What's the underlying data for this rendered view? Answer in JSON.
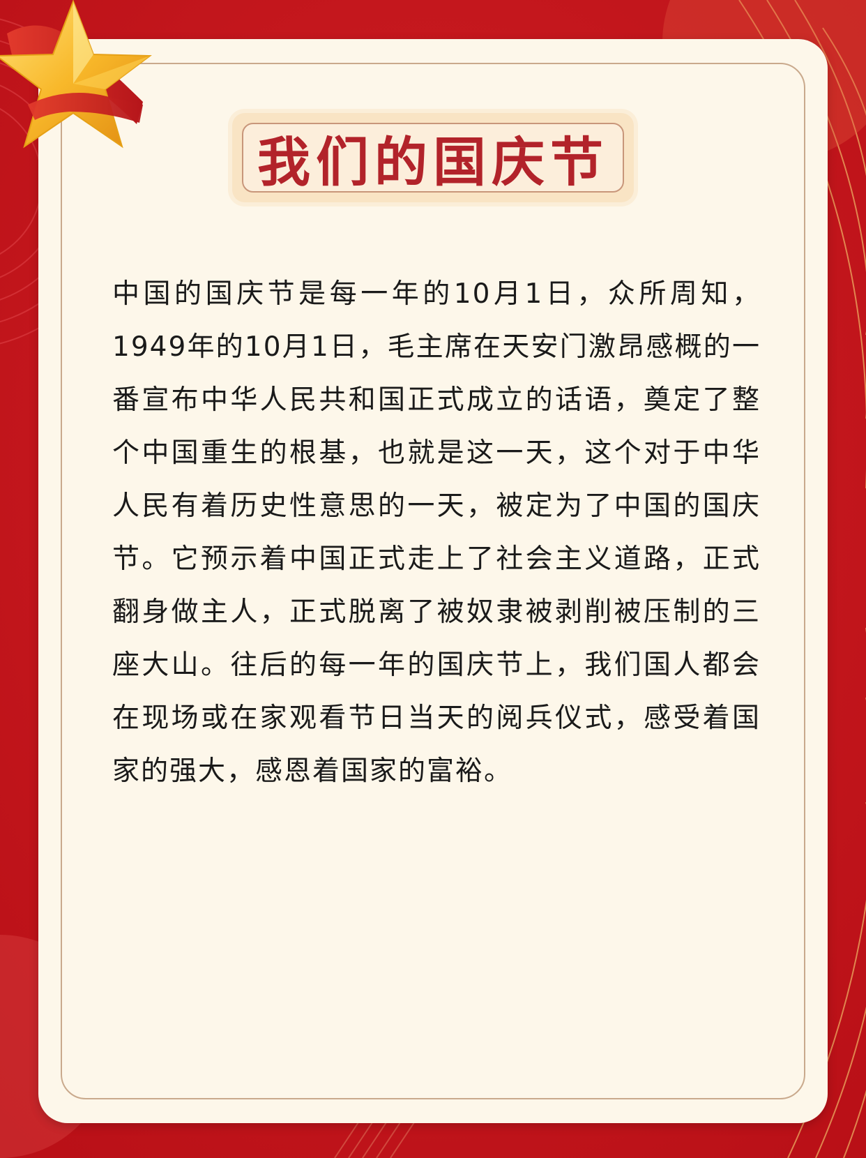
{
  "colors": {
    "background_red": "#c4161c",
    "card": "#fdf7ea",
    "title_red": "#b2232a",
    "gold": "#f3b32c"
  },
  "decorations": {
    "star_icon": "star-icon",
    "ribbon_icon": "ribbon-icon"
  },
  "title": "我们的国庆节",
  "body": "中国的国庆节是每一年的10月1日，众所周知，1949年的10月1日，毛主席在天安门激昂感概的一番宣布中华人民共和国正式成立的话语，奠定了整个中国重生的根基，也就是这一天，这个对于中华人民有着历史性意思的一天，被定为了中国的国庆节。它预示着中国正式走上了社会主义道路，正式翻身做主人，正式脱离了被奴隶被剥削被压制的三座大山。往后的每一年的国庆节上，我们国人都会在现场或在家观看节日当天的阅兵仪式，感受着国家的强大，感恩着国家的富裕。"
}
